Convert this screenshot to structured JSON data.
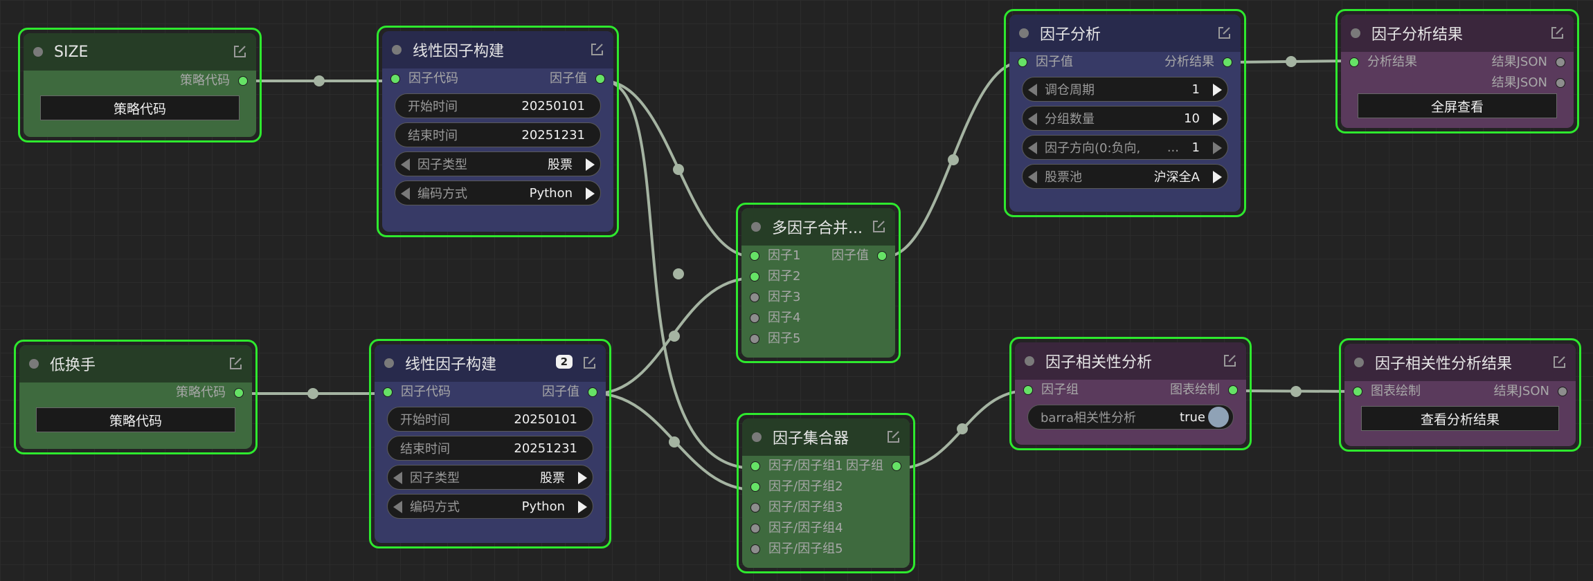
{
  "canvas": {
    "edit_icon": "edit-icon"
  },
  "nodes": {
    "size": {
      "title": "SIZE",
      "output": "策略代码",
      "button": "策略代码"
    },
    "low_turnover": {
      "title": "低换手",
      "output": "策略代码",
      "button": "策略代码"
    },
    "linear1": {
      "title": "线性因子构建",
      "input": "因子代码",
      "output": "因子值",
      "start_label": "开始时间",
      "start_value": "20250101",
      "end_label": "结束时间",
      "end_value": "20251231",
      "type_label": "因子类型",
      "type_value": "股票",
      "code_label": "编码方式",
      "code_value": "Python"
    },
    "linear2": {
      "title": "线性因子构建",
      "badge": "2",
      "input": "因子代码",
      "output": "因子值",
      "start_label": "开始时间",
      "start_value": "20250101",
      "end_label": "结束时间",
      "end_value": "20251231",
      "type_label": "因子类型",
      "type_value": "股票",
      "code_label": "编码方式",
      "code_value": "Python"
    },
    "merge": {
      "title": "多因子合并...",
      "inputs": [
        "因子1",
        "因子2",
        "因子3",
        "因子4",
        "因子5"
      ],
      "output": "因子值"
    },
    "collector": {
      "title": "因子集合器",
      "inputs": [
        "因子/因子组1",
        "因子/因子组2",
        "因子/因子组3",
        "因子/因子组4",
        "因子/因子组5"
      ],
      "output": "因子组"
    },
    "analysis": {
      "title": "因子分析",
      "input": "因子值",
      "output": "分析结果",
      "period_label": "调仓周期",
      "period_value": "1",
      "groups_label": "分组数量",
      "groups_value": "10",
      "direction_label": "因子方向(0:负向,",
      "direction_value": "1",
      "direction_ellipsis": "...",
      "pool_label": "股票池",
      "pool_value": "沪深全A"
    },
    "result": {
      "title": "因子分析结果",
      "input": "分析结果",
      "output1": "结果JSON",
      "output2": "结果JSON",
      "button": "全屏查看"
    },
    "corr": {
      "title": "因子相关性分析",
      "input": "因子组",
      "output": "图表绘制",
      "toggle_label": "barra相关性分析",
      "toggle_value": "true"
    },
    "corr_result": {
      "title": "因子相关性分析结果",
      "input": "图表绘制",
      "output": "结果JSON",
      "button": "查看分析结果"
    }
  },
  "colors": {
    "selection_border": "#2ee92e",
    "wire": "#a5b4a2",
    "slot_connected": "#66e266",
    "slot_empty": "#8d8d8d"
  }
}
